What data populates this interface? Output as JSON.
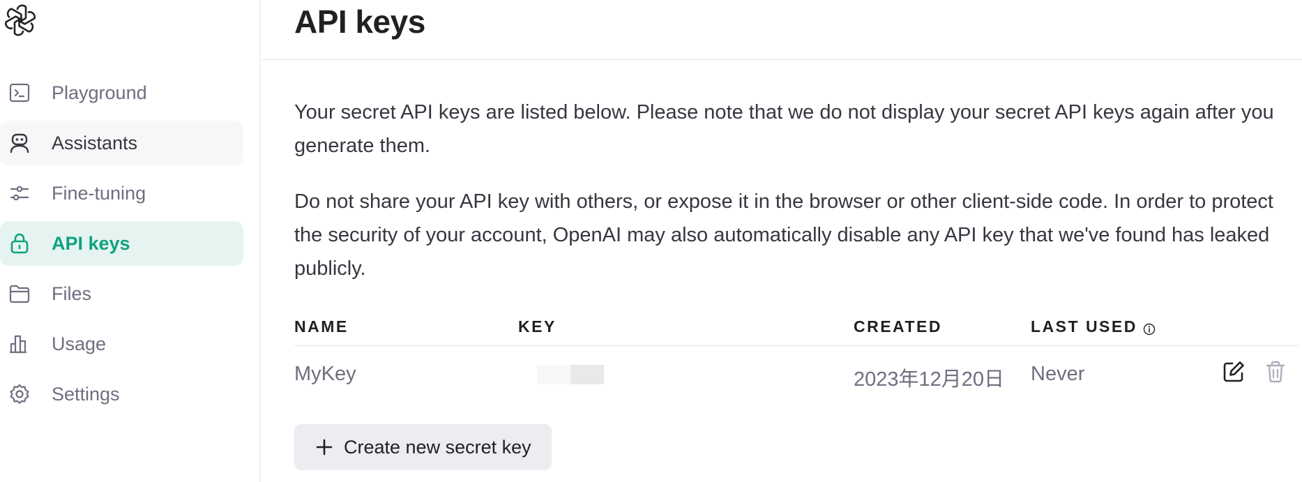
{
  "sidebar": {
    "logo": "openai-logo",
    "items": [
      {
        "label": "Playground",
        "icon": "terminal-icon",
        "state": "default"
      },
      {
        "label": "Assistants",
        "icon": "robot-icon",
        "state": "hover"
      },
      {
        "label": "Fine-tuning",
        "icon": "sliders-icon",
        "state": "default"
      },
      {
        "label": "API keys",
        "icon": "lock-icon",
        "state": "active"
      },
      {
        "label": "Files",
        "icon": "folder-icon",
        "state": "default"
      },
      {
        "label": "Usage",
        "icon": "bar-chart-icon",
        "state": "default"
      },
      {
        "label": "Settings",
        "icon": "gear-icon",
        "state": "default"
      }
    ]
  },
  "main": {
    "title": "API keys",
    "paragraphs": [
      "Your secret API keys are listed below. Please note that we do not display your secret API keys again after you generate them.",
      "Do not share your API key with others, or expose it in the browser or other client-side code. In order to protect the security of your account, OpenAI may also automatically disable any API key that we've found has leaked publicly."
    ],
    "table": {
      "headers": {
        "name": "NAME",
        "key": "KEY",
        "created": "CREATED",
        "last_used": "LAST USED"
      },
      "rows": [
        {
          "name": "MyKey",
          "key": "",
          "created": "2023年12月20日",
          "last_used": "Never"
        }
      ]
    },
    "create_button": "Create new secret key"
  },
  "colors": {
    "accent": "#10a37f",
    "active_bg": "#e6f4f1",
    "hover_bg": "#f7f7f8",
    "button_bg": "#ececf1",
    "muted_text": "#6e6e80"
  }
}
